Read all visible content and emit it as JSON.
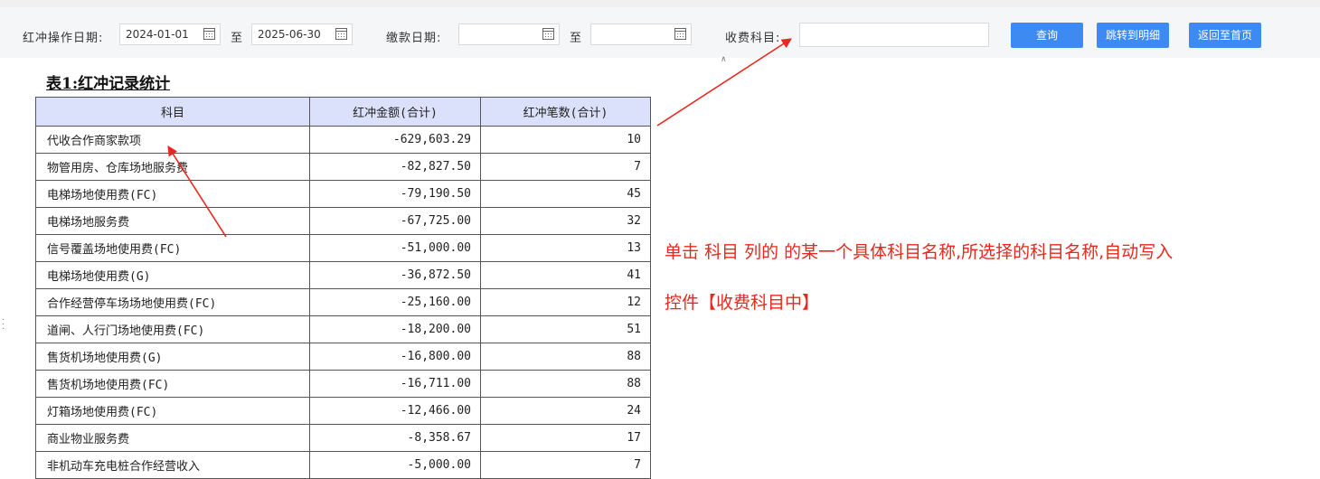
{
  "filters": {
    "op_date_label": "红冲操作日期:",
    "op_date_from": "2024-01-01",
    "op_date_sep": "至",
    "op_date_to": "2025-06-30",
    "pay_date_label": "缴款日期:",
    "pay_date_from": "",
    "pay_date_sep": "至",
    "pay_date_to": "",
    "subject_label": "收费科目:",
    "subject_value": ""
  },
  "buttons": {
    "query": "查询",
    "jump_detail": "跳转到明细",
    "back_home": "返回至首页"
  },
  "table": {
    "title": "表1:红冲记录统计",
    "headers": [
      "科目",
      "红冲金额(合计)",
      "红冲笔数(合计)"
    ],
    "rows": [
      {
        "name": "代收合作商家款项",
        "amount": "-629,603.29",
        "count": "10"
      },
      {
        "name": "物管用房、仓库场地服务费",
        "amount": "-82,827.50",
        "count": "7"
      },
      {
        "name": "电梯场地使用费(FC)",
        "amount": "-79,190.50",
        "count": "45"
      },
      {
        "name": "电梯场地服务费",
        "amount": "-67,725.00",
        "count": "32"
      },
      {
        "name": "信号覆盖场地使用费(FC)",
        "amount": "-51,000.00",
        "count": "13"
      },
      {
        "name": "电梯场地使用费(G)",
        "amount": "-36,872.50",
        "count": "41"
      },
      {
        "name": "合作经营停车场场地使用费(FC)",
        "amount": "-25,160.00",
        "count": "12"
      },
      {
        "name": "道闸、人行门场地使用费(FC)",
        "amount": "-18,200.00",
        "count": "51"
      },
      {
        "name": "售货机场地使用费(G)",
        "amount": "-16,800.00",
        "count": "88"
      },
      {
        "name": "售货机场地使用费(FC)",
        "amount": "-16,711.00",
        "count": "88"
      },
      {
        "name": "灯箱场地使用费(FC)",
        "amount": "-12,466.00",
        "count": "24"
      },
      {
        "name": "商业物业服务费",
        "amount": "-8,358.67",
        "count": "17"
      },
      {
        "name": "非机动车充电桩合作经营收入",
        "amount": "-5,000.00",
        "count": "7"
      }
    ]
  },
  "annotation": {
    "line1": "单击 科目 列的 的某一个具体科目名称,所选择的科目名称,自动写入",
    "line2": "控件【收费科目中】",
    "color": "#e8281e"
  }
}
